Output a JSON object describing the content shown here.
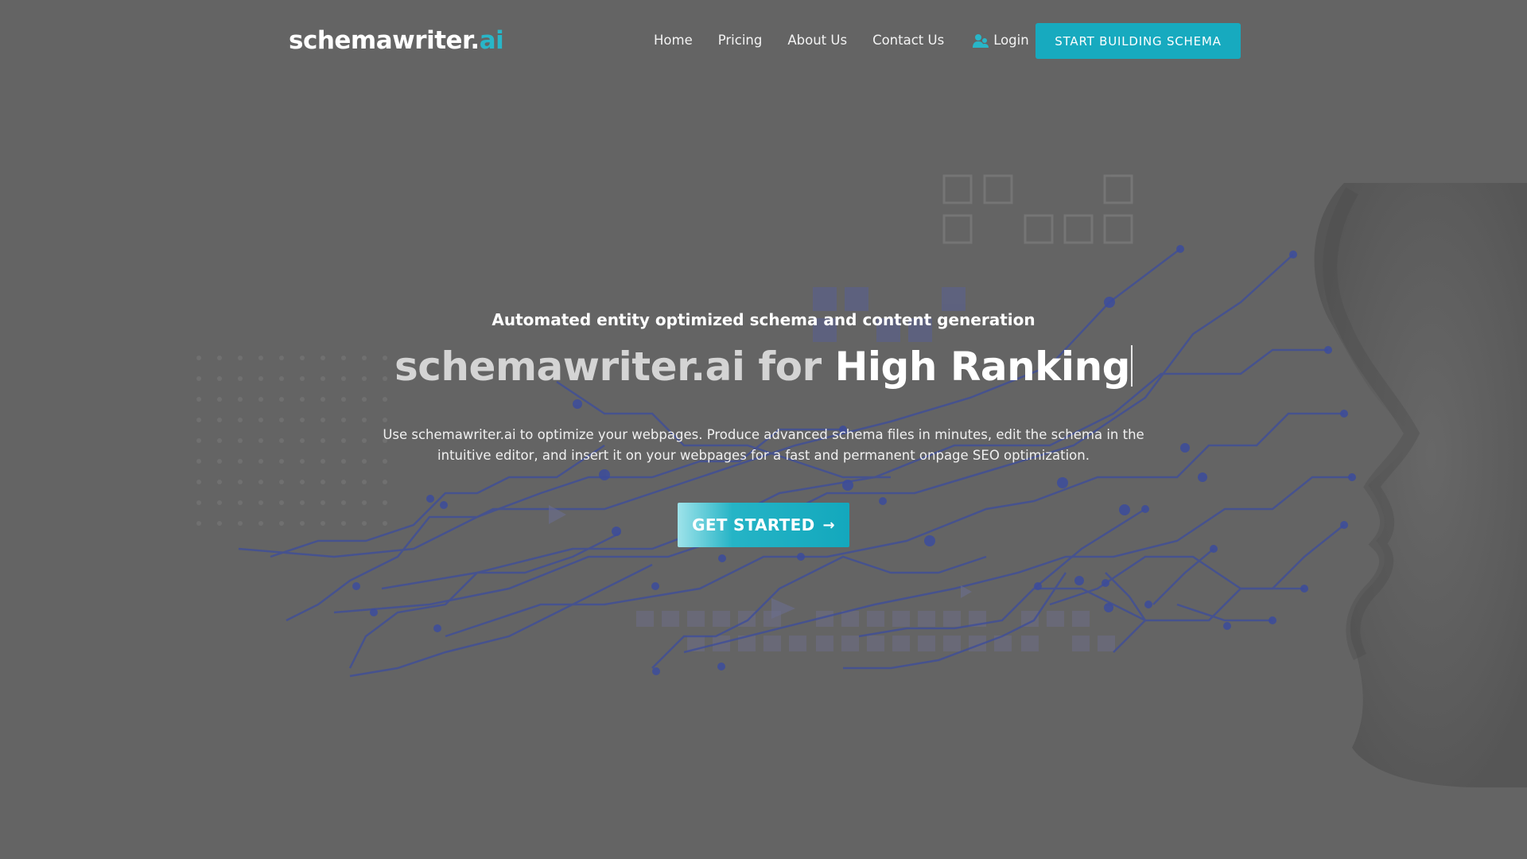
{
  "header": {
    "logo_main": "schemawriter.",
    "logo_accent": "ai",
    "nav": [
      {
        "label": "Home"
      },
      {
        "label": "Pricing"
      },
      {
        "label": "About Us"
      },
      {
        "label": "Contact Us"
      }
    ],
    "login_label": "Login",
    "cta_label": "START BUILDING SCHEMA"
  },
  "hero": {
    "eyebrow": "Automated entity optimized schema and content generation",
    "headline_lead": "schemawriter.ai for ",
    "headline_typed": "High Ranking",
    "description": "Use schemawriter.ai to optimize your webpages. Produce advanced schema files in minutes, edit the schema in the intuitive editor, and insert it on your webpages for a fast and permanent onpage SEO optimization.",
    "button_label": "GET STARTED",
    "button_arrow": "→"
  },
  "colors": {
    "accent": "#17aabf",
    "logo_accent": "#28b6c8",
    "background": "#646464",
    "circuit": "#3a4a9a"
  }
}
